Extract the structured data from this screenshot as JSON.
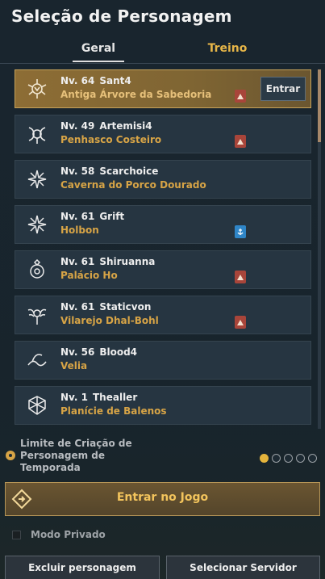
{
  "title": "Seleção de Personagem",
  "tabs": [
    {
      "label": "Geral"
    },
    {
      "label": "Treino"
    }
  ],
  "characters": [
    {
      "level": "Nv. 64",
      "name": "Sant4",
      "location": "Antiga Árvore da Sabedoria",
      "badge": "red",
      "icon": "mystic-class-icon"
    },
    {
      "level": "Nv. 49",
      "name": "Artemisi4",
      "location": "Penhasco Costeiro",
      "badge": "red",
      "icon": "axe-class-icon"
    },
    {
      "level": "Nv. 58",
      "name": "Scarchoice",
      "location": "Caverna do Porco Dourado",
      "badge": null,
      "icon": "star-class-icon"
    },
    {
      "level": "Nv. 61",
      "name": "Grift",
      "location": "Holbon",
      "badge": "blue",
      "icon": "star-class-icon"
    },
    {
      "level": "Nv. 61",
      "name": "Shiruanna",
      "location": "Palácio Ho",
      "badge": "red",
      "icon": "orb-class-icon"
    },
    {
      "level": "Nv. 61",
      "name": "Staticvon",
      "location": "Vilarejo Dhal-Bohl",
      "badge": "red",
      "icon": "wing-class-icon"
    },
    {
      "level": "Nv. 56",
      "name": "Blood4",
      "location": "Velia",
      "badge": null,
      "icon": "wave-class-icon"
    },
    {
      "level": "Nv. 1",
      "name": "Thealler",
      "location": "Planície de Balenos",
      "badge": null,
      "icon": "shield-class-icon"
    }
  ],
  "enter_button": "Entrar",
  "season": {
    "text": "Limite de Criação de Personagem de Temporada",
    "slots_filled": 1,
    "slots_total": 5
  },
  "enter_game": "Entrar no Jogo",
  "private_mode": "Modo Privado",
  "delete_button": "Excluir personagem",
  "server_button": "Selecionar Servidor",
  "colors": {
    "accent_gold": "#d7a446",
    "badge_red": "#a8453a",
    "badge_blue": "#2f86c8"
  }
}
